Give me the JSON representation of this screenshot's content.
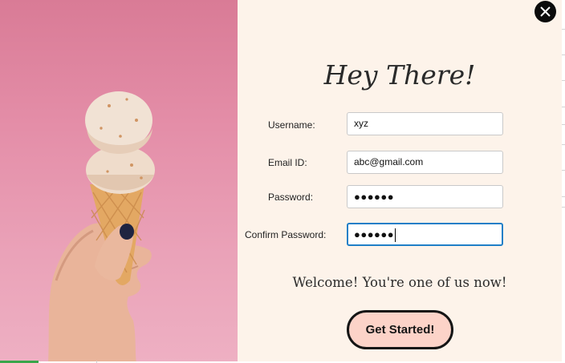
{
  "dialog": {
    "title": "Hey There!",
    "welcome_message": "Welcome! You're one of us now!",
    "get_started_label": "Get Started!"
  },
  "form": {
    "username": {
      "label": "Username:",
      "value": "xyz"
    },
    "email": {
      "label": "Email ID:",
      "value": "abc@gmail.com"
    },
    "password": {
      "label": "Password:",
      "value": "●●●●●●"
    },
    "confirm_password": {
      "label": "Confirm Password:",
      "value": "●●●●●●"
    }
  },
  "icons": {
    "close": "close-icon"
  },
  "colors": {
    "panel_background": "#fdf3ea",
    "photo_background": "#e48ea8",
    "button_fill": "#fcd3c8",
    "button_border": "#151515",
    "focus_border": "#1f7fc7"
  }
}
